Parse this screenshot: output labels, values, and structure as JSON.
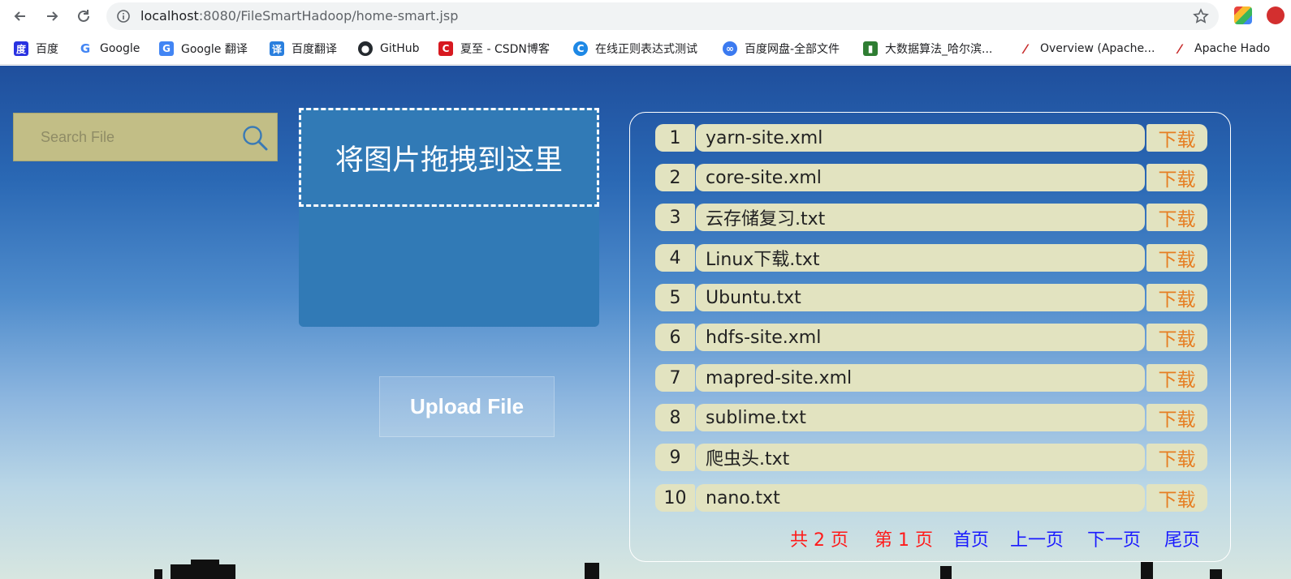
{
  "browser": {
    "url_host": "localhost",
    "url_path": ":8080/FileSmartHadoop/home-smart.jsp",
    "bookmarks": [
      {
        "label": "百度",
        "icon": "baidu-paw-icon",
        "color": "#2932e1"
      },
      {
        "label": "Google",
        "icon": "google-icon",
        "color": "#4285f4"
      },
      {
        "label": "Google 翻译",
        "icon": "google-translate-icon",
        "color": "#4285f4"
      },
      {
        "label": "百度翻译",
        "icon": "baidu-translate-icon",
        "color": "#2a7fde"
      },
      {
        "label": "GitHub",
        "icon": "github-icon",
        "color": "#24292e"
      },
      {
        "label": "夏至 - CSDN博客",
        "icon": "csdn-icon",
        "color": "#d71920"
      },
      {
        "label": "在线正则表达式测试",
        "icon": "regex-site-icon",
        "color": "#1e88e5"
      },
      {
        "label": "百度网盘-全部文件",
        "icon": "baidu-netdisk-icon",
        "color": "#3b7af0"
      },
      {
        "label": "大数据算法_哈尔滨...",
        "icon": "map-book-icon",
        "color": "#2e7d32"
      },
      {
        "label": "Overview (Apache...",
        "icon": "apache-feather-icon",
        "color": "#c62828"
      },
      {
        "label": "Apache Hado",
        "icon": "apache-feather-icon",
        "color": "#c62828"
      }
    ]
  },
  "search": {
    "placeholder": "Search File",
    "icon": "magnifier-icon",
    "box_color": "#c2be86"
  },
  "dropzone": {
    "text": "将图片拖拽到这里"
  },
  "upload": {
    "label": "Upload File"
  },
  "files": [
    {
      "num": "1",
      "name": "yarn-site.xml",
      "action": "下载"
    },
    {
      "num": "2",
      "name": "core-site.xml",
      "action": "下载"
    },
    {
      "num": "3",
      "name": "云存储复习.txt",
      "action": "下载"
    },
    {
      "num": "4",
      "name": "Linux下载.txt",
      "action": "下载"
    },
    {
      "num": "5",
      "name": "Ubuntu.txt",
      "action": "下载"
    },
    {
      "num": "6",
      "name": "hdfs-site.xml",
      "action": "下载"
    },
    {
      "num": "7",
      "name": "mapred-site.xml",
      "action": "下载"
    },
    {
      "num": "8",
      "name": "sublime.txt",
      "action": "下载"
    },
    {
      "num": "9",
      "name": "爬虫头.txt",
      "action": "下载"
    },
    {
      "num": "10",
      "name": "nano.txt",
      "action": "下载"
    }
  ],
  "pagination": {
    "total": "共 2 页",
    "current": "第 1 页",
    "first": "首页",
    "prev": "上一页",
    "next": "下一页",
    "last": "尾页"
  },
  "colors": {
    "download_link": "#e67e22",
    "pager_info": "#ff1a1a",
    "pager_link": "#1a1aff",
    "row_bg": "#e2e3c0"
  }
}
